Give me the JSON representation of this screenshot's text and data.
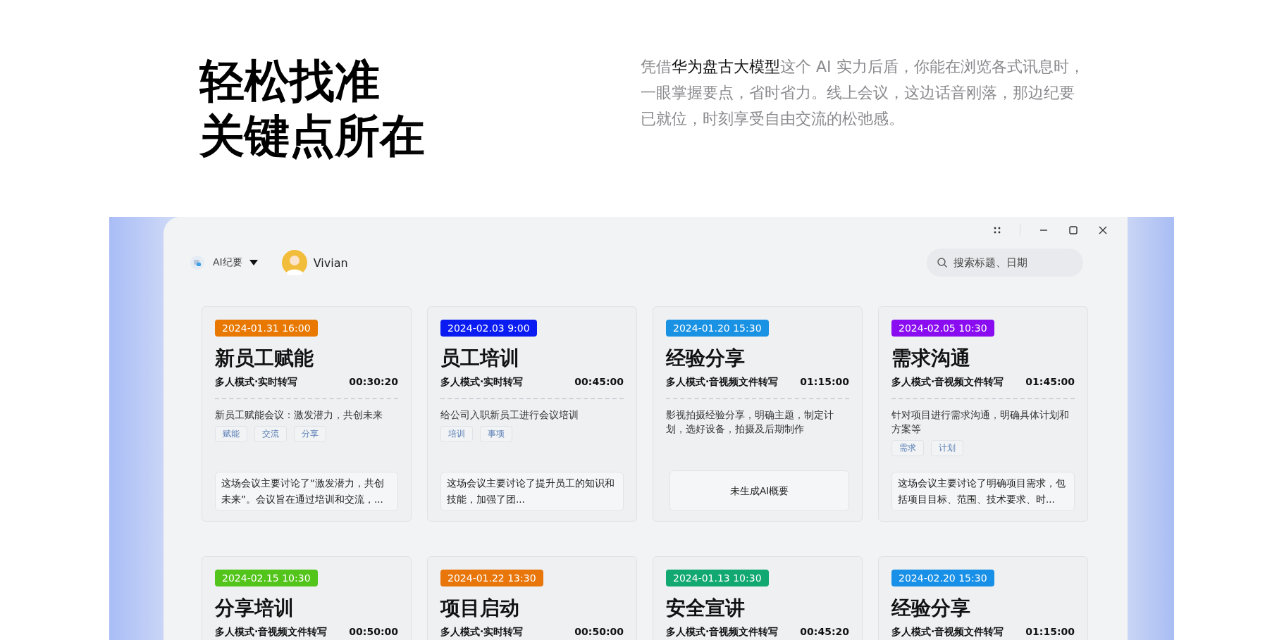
{
  "hero": {
    "heading_lines": [
      "轻松找准",
      "关键点所在"
    ],
    "intro": "凭借**华为盘古大模型**这个 AI 实力后盾，你能在浏览各式讯息时，一眼掌握要点，省时省力。线上会议，这边话音刚落，那边纪要已就位，时刻享受自由交流的松弛感。"
  },
  "window": {
    "app_menu": "AI纪要",
    "user": "Vivian",
    "search": {
      "placeholder": "搜索标题、日期"
    }
  },
  "meetings": [
    {
      "date": "2024-01.31 16:00",
      "color": "#e87800",
      "title": "新员工赋能",
      "mode": "多人模式·实时转写",
      "duration": "00:30:20",
      "description": "新员工赋能会议：激发潜力，共创未来",
      "tags": [
        "赋能",
        "交流",
        "分享"
      ],
      "summary": {
        "kind": "ai",
        "text": "这场会议主要讨论了“激发潜力，共创未来”。会议旨在通过培训和交流，..."
      }
    },
    {
      "date": "2024-02.03 9:00",
      "color": "#0a1cf2",
      "title": "员工培训",
      "mode": "多人模式·实时转写",
      "duration": "00:45:00",
      "description": "给公司入职新员工进行会议培训",
      "tags": [
        "培训",
        "事项"
      ],
      "summary": {
        "kind": "ai",
        "text": "这场会议主要讨论了提升员工的知识和技能，加强了团..."
      }
    },
    {
      "date": "2024-01.20 15:30",
      "color": "#1a92e4",
      "title": "经验分享",
      "mode": "多人模式·音视频文件转写",
      "duration": "01:15:00",
      "description": "影视拍摄经验分享，明确主题，制定计划，选好设备，拍摄及后期制作",
      "summary": {
        "kind": "empty",
        "text": "未生成AI概要"
      }
    },
    {
      "date": "2024-02.05 10:30",
      "color": "#8a0cf0",
      "title": "需求沟通",
      "mode": "多人模式·音视频文件转写",
      "duration": "01:45:00",
      "description": "针对项目进行需求沟通，明确具体计划和方案等",
      "tags": [
        "需求",
        "计划"
      ],
      "summary": {
        "kind": "ai",
        "text": "这场会议主要讨论了明确项目需求，包括项目目标、范围、技术要求、时..."
      }
    },
    {
      "date": "2024-02.15 10:30",
      "color": "#52c41a",
      "title": "分享培训",
      "mode": "多人模式·音视频文件转写",
      "duration": "00:50:00"
    },
    {
      "date": "2024-01.22 13:30",
      "color": "#e8760a",
      "title": "项目启动",
      "mode": "多人模式·实时转写",
      "duration": "00:50:00"
    },
    {
      "date": "2024-01.13 10:30",
      "color": "#12a872",
      "title": "安全宣讲",
      "mode": "多人模式·音视频文件转写",
      "duration": "00:45:20"
    },
    {
      "date": "2024-02.20 15:30",
      "color": "#1890e8",
      "title": "经验分享",
      "mode": "多人模式·音视频文件转写",
      "duration": "01:15:00"
    }
  ]
}
